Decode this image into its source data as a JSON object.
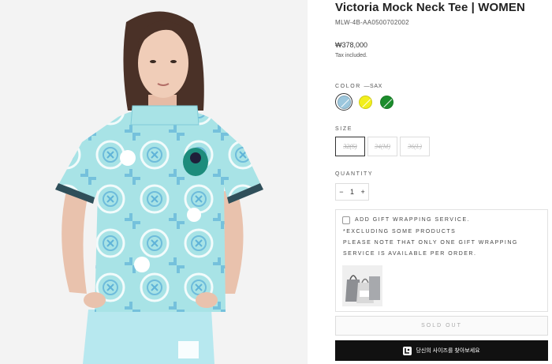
{
  "product": {
    "title": "Victoria Mock Neck Tee | WOMEN",
    "sku": "MLW-4B-AA0500702002",
    "price": "₩378,000",
    "tax_note": "Tax included.",
    "image_alt": "model-wearing-light-blue-mock-neck-tee"
  },
  "color": {
    "label": "COLOR",
    "selected_value": "—SAX",
    "swatches": [
      {
        "name": "SAX",
        "hex": "#9cc7dd"
      },
      {
        "name": "YELLOW",
        "hex": "#f2ef1c"
      },
      {
        "name": "GREEN",
        "hex": "#1b8d2c"
      }
    ]
  },
  "size": {
    "label": "SIZE",
    "options": [
      "32(S)",
      "34(M)",
      "36(L)"
    ]
  },
  "quantity": {
    "label": "QUANTITY",
    "minus": "−",
    "value": "1",
    "plus": "+"
  },
  "gift": {
    "title": "ADD GIFT WRAPPING SERVICE.",
    "line1": "*EXCLUDING SOME PRODUCTS",
    "line2": "PLEASE NOTE THAT ONLY ONE GIFT WRAPPING",
    "line3": "SERVICE IS AVAILABLE PER ORDER."
  },
  "buttons": {
    "sold_out": "SOLD OUT",
    "find_size": "당신의 사이즈를 찾아보세요"
  },
  "colors": {
    "shirt": "#a8e3e6",
    "shirt_pattern": "#5fb3d8",
    "accent_black": "#111111"
  }
}
